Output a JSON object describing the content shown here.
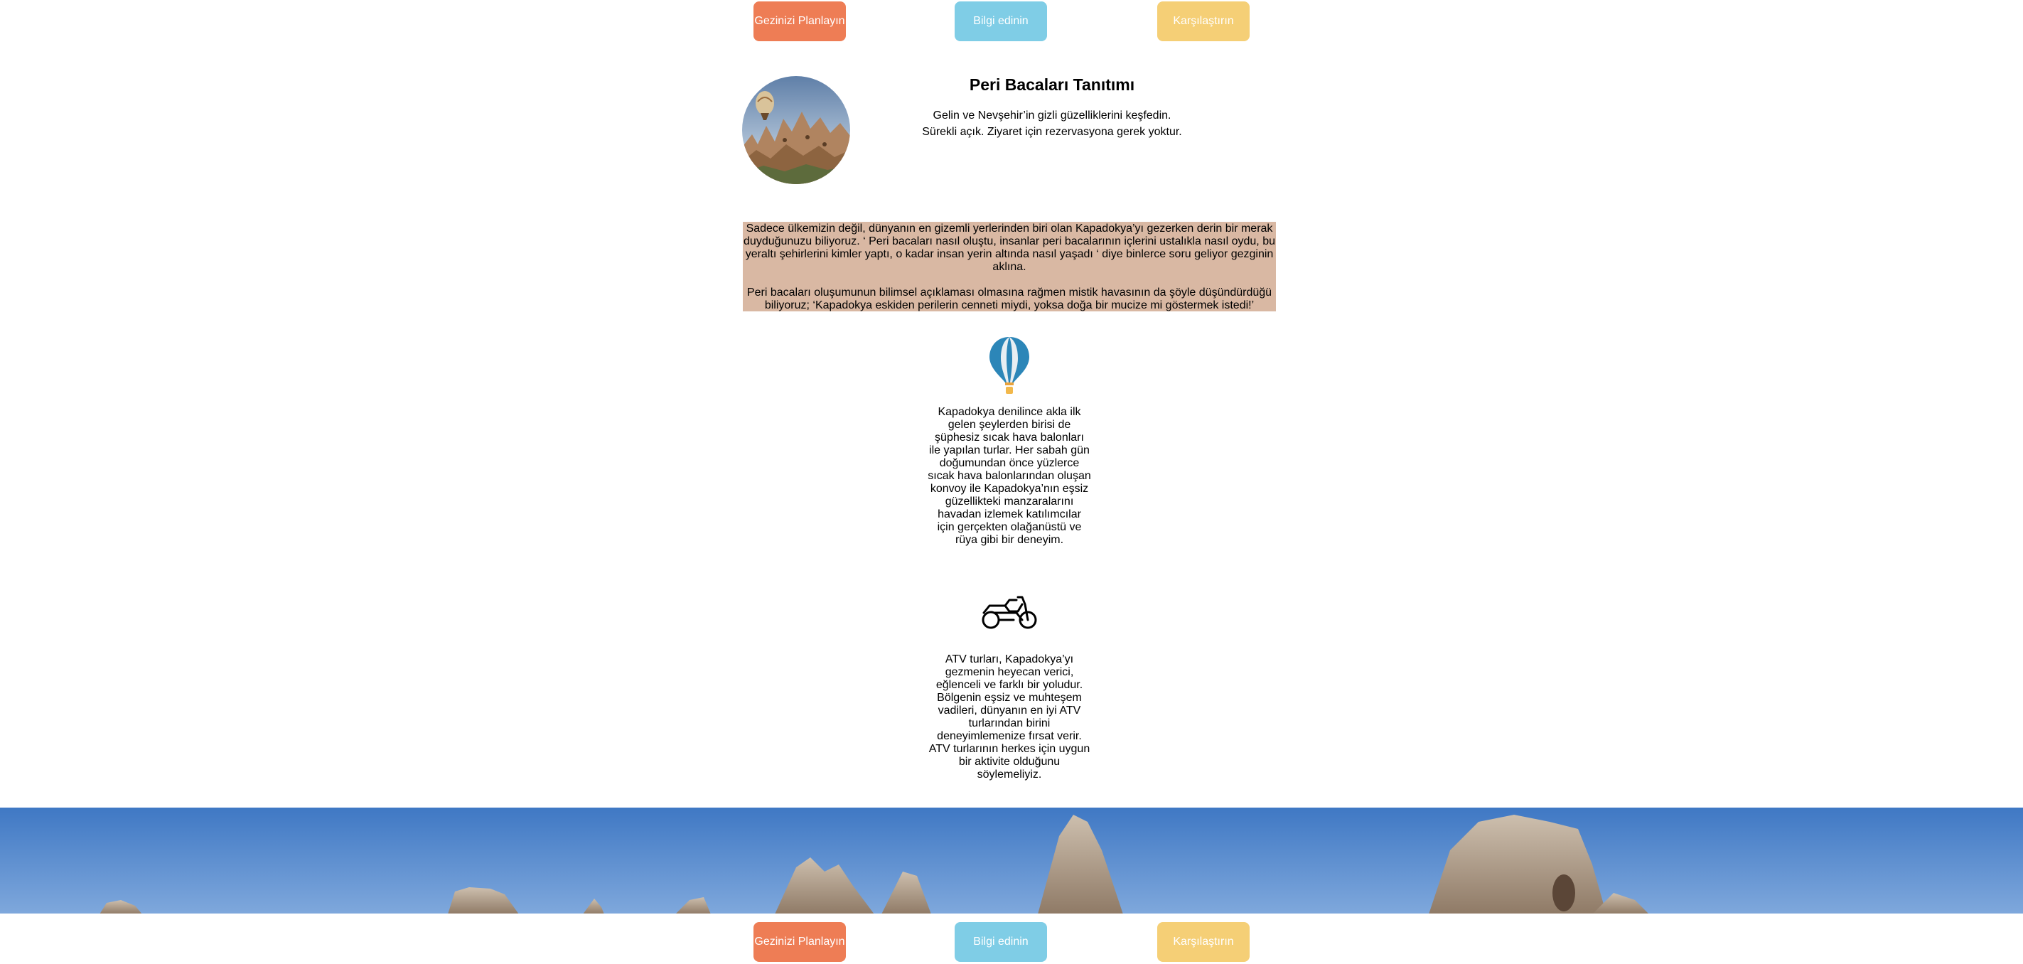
{
  "nav": {
    "plan_label": "Gezinizi Planlayın",
    "info_label": "Bilgi edinin",
    "compare_label": "Karşılaştırın"
  },
  "intro": {
    "title": "Peri Bacaları Tanıtımı",
    "line1": "Gelin ve Nevşehir’in gizli güzelliklerini keşfedin.",
    "line2": "Sürekli açık. Ziyaret için rezervasyona gerek yoktur."
  },
  "story": {
    "p1": "Sadece ülkemizin değil, dünyanın en gizemli yerlerinden biri olan Kapadokya’yı gezerken derin bir merak duyduğunuzu biliyoruz. ‘ Peri bacaları nasıl oluştu, insanlar peri bacalarının içlerini ustalıkla nasıl oydu, bu yeraltı şehirlerini kimler yaptı, o kadar insan yerin altında nasıl yaşadı ‘ diye binlerce soru geliyor gezginin aklına.",
    "p2": "Peri bacaları oluşumunun bilimsel açıklaması olmasına rağmen mistik havasının da şöyle düşündürdüğü biliyoruz; ‘Kapadokya eskiden perilerin cenneti miydi, yoksa doğa bir mucize mi göstermek istedi!’"
  },
  "balloon": {
    "icon": "hot-air-balloon-icon",
    "text": "Kapadokya denilince akla ilk gelen şeylerden birisi de şüphesiz sıcak hava balonları ile yapılan turlar. Her sabah gün doğumundan önce yüzlerce sıcak hava balonlarından oluşan konvoy ile Kapadokya’nın eşsiz güzellikteki manzaralarını havadan izlemek katılımcılar için gerçekten olağanüstü ve rüya gibi bir deneyim."
  },
  "atv": {
    "icon": "motorbike-icon",
    "text": "ATV turları, Kapadokya’yı gezmenin heyecan verici, eğlenceli ve farklı bir yoludur. Bölgenin eşsiz ve muhteşem vadileri, dünyanın en iyi ATV turlarından birini deneyimlemenize fırsat verir. ATV turlarının herkes için uygun bir aktivite olduğunu söylemeliyiz."
  },
  "colors": {
    "plan": "#ee7d55",
    "info": "#7fcde6",
    "compare": "#f5cf76",
    "story_bg": "#d9b8a3"
  }
}
